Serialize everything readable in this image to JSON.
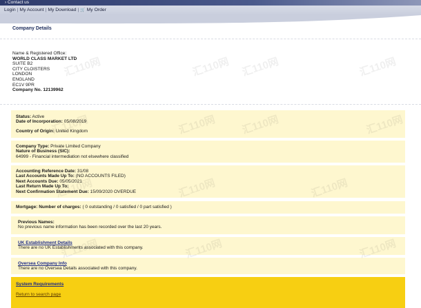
{
  "header": {
    "contact_label": "› Contact us",
    "menu": [
      {
        "label": "Login"
      },
      {
        "label": "My Account"
      },
      {
        "label": "My Download"
      },
      {
        "label": "My Order",
        "icon": "cart-icon"
      }
    ],
    "colors": {
      "bar_dark": "#2d3a6b",
      "bar_light": "#c9cedd"
    }
  },
  "page_title": "Company Details",
  "registered_office": {
    "heading": "Name & Registered Office:",
    "company_name": "WORLD CLASS MARKET LTD",
    "address": [
      "SUITE B2",
      "CITY CLOISTERS",
      "LONDON",
      "ENGLAND",
      "EC1V 9PR"
    ],
    "company_no": "Company No. 12139962"
  },
  "status_box": {
    "status_label": "Status:",
    "status_value": "Active",
    "incorporation_label": "Date of Incorporation:",
    "incorporation_value": "05/08/2019",
    "origin_label": "Country of Origin:",
    "origin_value": "United Kingdom"
  },
  "type_box": {
    "type_label": "Company Type:",
    "type_value": "Private Limited Company",
    "nature_label": "Nature of Business (SIC):",
    "nature_value": "64999 - Financial intermediation not elsewhere classified"
  },
  "accounts_box": {
    "ref_label": "Accounting Reference Date:",
    "ref_value": "31/08",
    "last_acc_label": "Last Accounts Made Up To:",
    "last_acc_value": "(NO ACCOUNTS FILED)",
    "next_acc_label": "Next Accounts Due:",
    "next_acc_value": "05/05/2021",
    "last_return_label": "Last Return Made Up To:",
    "next_conf_label": "Next Confirmation Statement Due:",
    "next_conf_value": "15/09/2020 OVERDUE"
  },
  "mortgage_box": {
    "label": "Mortgage: Number of charges:",
    "value": "( 0 outstanding / 0 satisfied / 0 part satisfied )"
  },
  "previous_names_box": {
    "title": "Previous Names:",
    "text": "No previous name information has been recorded over the last 20 years."
  },
  "uk_box": {
    "title": "UK Establishment Details",
    "text": "There are no UK Establishments associated with this company."
  },
  "oversea_box": {
    "title": "Oversea Company Info",
    "text": "There are no Oversea Details associated with this company."
  },
  "footer": {
    "system_label": "System Requirements",
    "return_label": "Return to search page",
    "colors": {
      "panel": "#fef7cf",
      "footer": "#f7cf12"
    }
  },
  "watermark": "汇110网"
}
